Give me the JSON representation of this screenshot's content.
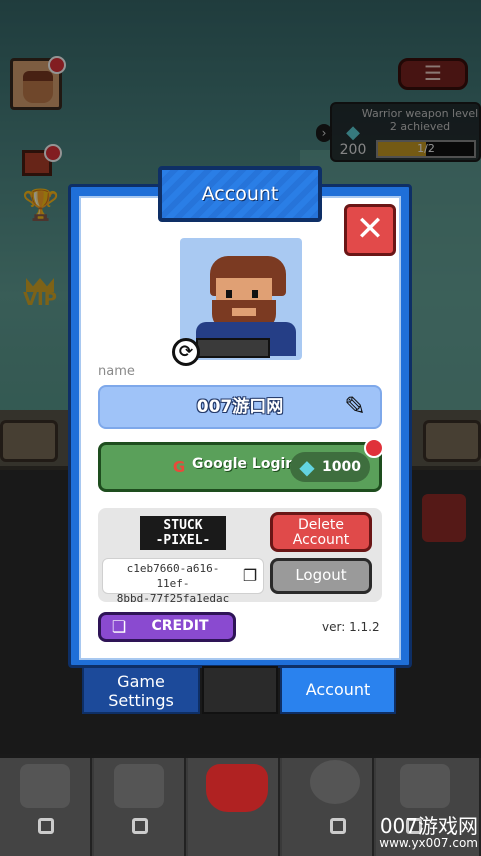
{
  "quest": {
    "title": "Warrior weapon level 2 achieved",
    "gems": "200",
    "progress_label": "1/2",
    "progress_fraction": 0.5
  },
  "dialog": {
    "title": "Account",
    "name_label": "name",
    "name_value": "007游口网",
    "google_login_label": "Google Login",
    "google_reward": "1000",
    "logo_line1": "STUCK",
    "logo_line2": "-PIXEL-",
    "user_id_line1": "c1eb7660-a616-11ef-",
    "user_id_line2": "8bbd-77f25fa1edac",
    "delete_label_line1": "Delete",
    "delete_label_line2": "Account",
    "logout_label": "Logout",
    "credit_label": "CREDIT",
    "version": "ver: 1.1.2"
  },
  "tabs": {
    "game_settings_line1": "Game",
    "game_settings_line2": "Settings",
    "account": "Account"
  },
  "hud": {
    "vip_label": "VIP"
  },
  "watermark": {
    "line1": "007游戏网",
    "line2": "www.yx007.com"
  },
  "icons": {
    "close": "close-icon",
    "edit": "edit-icon",
    "swap": "swap-icon",
    "copy": "copy-icon",
    "gem": "gem-icon",
    "menu": "menu-icon"
  },
  "colors": {
    "dialog_blue": "#1f6fd8",
    "google_green": "#5aa05a",
    "delete_red": "#e04a4a",
    "credit_purple": "#8a4ad0",
    "name_field": "#9fc3f8"
  }
}
